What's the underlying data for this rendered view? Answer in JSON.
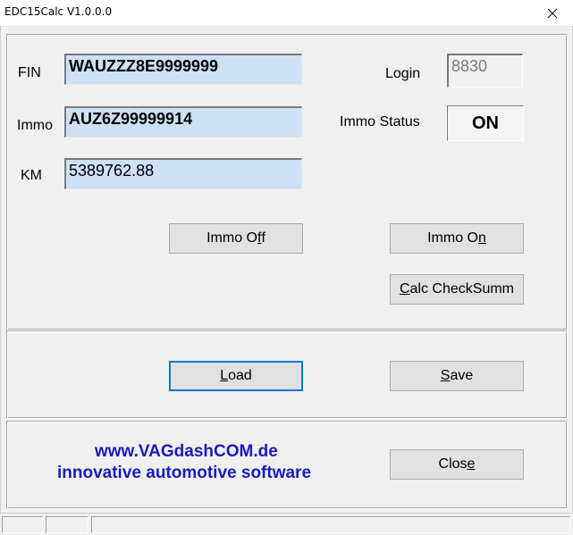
{
  "window": {
    "title": "EDC15Calc V1.0.0.0"
  },
  "labels": {
    "fin": "FIN",
    "immo": "Immo",
    "km": "KM",
    "login": "Login",
    "immo_status": "Immo Status"
  },
  "fields": {
    "fin": "WAUZZZ8E9999999",
    "immo": "AUZ6Z99999914",
    "km": "5389762.88",
    "login": "8830"
  },
  "status": {
    "immo_status_value": "ON"
  },
  "buttons": {
    "immo_off": {
      "pre": "Immo O",
      "hot": "f",
      "post": "f"
    },
    "immo_on": {
      "pre": "Immo O",
      "hot": "n",
      "post": ""
    },
    "calc_checksumm": {
      "pre": "",
      "hot": "C",
      "post": "alc CheckSumm"
    },
    "load": {
      "pre": "",
      "hot": "L",
      "post": "oad"
    },
    "save": {
      "pre": "",
      "hot": "S",
      "post": "ave"
    },
    "close": {
      "pre": "Clos",
      "hot": "e",
      "post": ""
    }
  },
  "branding": {
    "line1": "www.VAGdashCOM.de",
    "line2": "innovative automotive software"
  },
  "colors": {
    "field_bg": "#cde0f7",
    "brand": "#1a1ab8",
    "focus": "#0078d7"
  }
}
